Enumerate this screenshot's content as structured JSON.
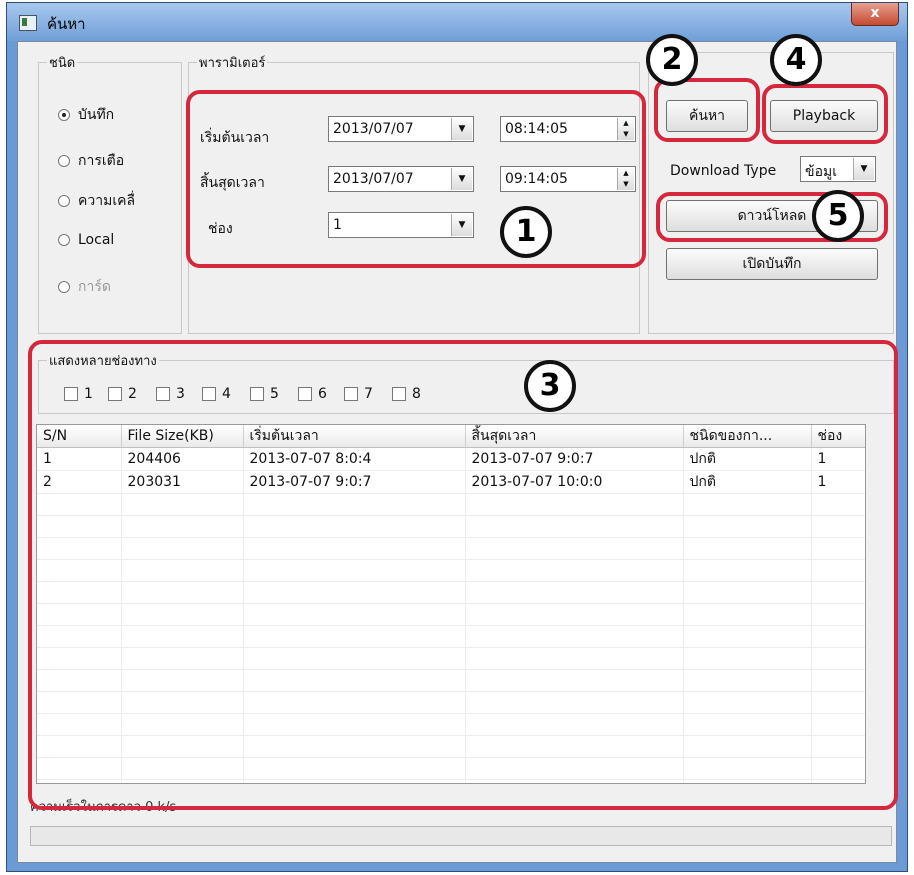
{
  "window": {
    "title": "ค้นหา",
    "close": "x"
  },
  "type_group": {
    "legend": "ชนิด",
    "options": [
      {
        "label": "บันทึก",
        "selected": true,
        "enabled": true
      },
      {
        "label": "การเตือ",
        "selected": false,
        "enabled": true
      },
      {
        "label": "ความเคลื่",
        "selected": false,
        "enabled": true
      },
      {
        "label": "Local",
        "selected": false,
        "enabled": true
      },
      {
        "label": "การ์ด",
        "selected": false,
        "enabled": false
      }
    ]
  },
  "params": {
    "legend": "พารามิเตอร์",
    "start_label": "เริ่มต้นเวลา",
    "start_date": "2013/07/07",
    "start_time": "08:14:05",
    "end_label": "สิ้นสุดเวลา",
    "end_date": "2013/07/07",
    "end_time": "09:14:05",
    "channel_label": "ช่อง",
    "channel_value": "1"
  },
  "actions": {
    "search": "ค้นหา",
    "playback": "Playback",
    "download_type_label": "Download Type",
    "download_type_value": "ข้อมูเ",
    "download": "ดาวน์โหลด",
    "open_record": "เปิดบันทึก"
  },
  "multi_channel": {
    "legend": "แสดงหลายช่องทาง",
    "channels": [
      "1",
      "2",
      "3",
      "4",
      "5",
      "6",
      "7",
      "8"
    ]
  },
  "table": {
    "columns": [
      "S/N",
      "File Size(KB)",
      "เริ่มต้นเวลา",
      "สิ้นสุดเวลา",
      "ชนิดของกา...",
      "ช่อง"
    ],
    "rows": [
      [
        "1",
        "204406",
        "2013-07-07 8:0:4",
        "2013-07-07 9:0:7",
        "ปกติ",
        "1"
      ],
      [
        "2",
        "203031",
        "2013-07-07 9:0:7",
        "2013-07-07 10:0:0",
        "ปกติ",
        "1"
      ]
    ]
  },
  "status": {
    "text": "ความเร็วในการดาว      0 k/s",
    "progress": 0
  },
  "annotations": [
    "1",
    "2",
    "3",
    "4",
    "5"
  ],
  "colors": {
    "annotation_ring": "#d6283c",
    "titlebar": "#6f9fd8"
  }
}
